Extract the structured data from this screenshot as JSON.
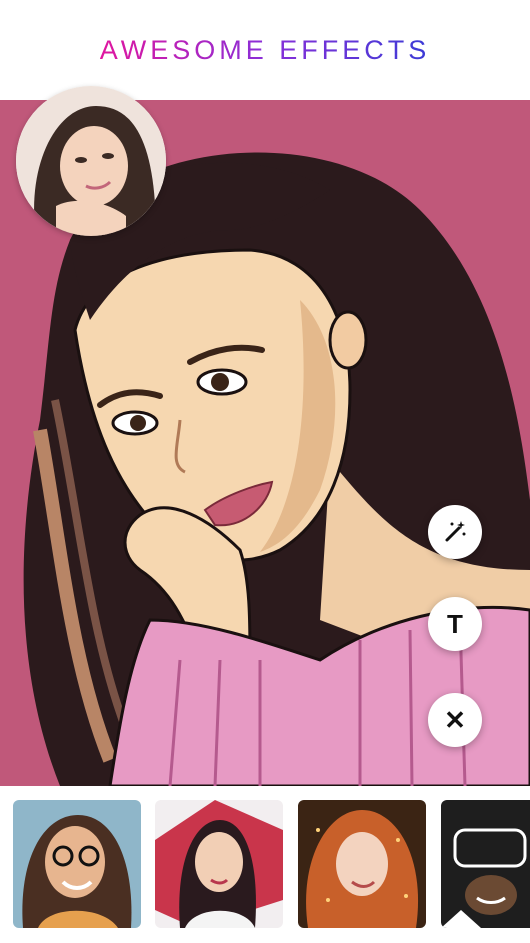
{
  "header": {
    "title": "AWESOME EFFECTS"
  },
  "canvas": {
    "background_color": "#c0587a"
  },
  "avatar": {
    "label": "original-photo-thumbnail"
  },
  "actions": [
    {
      "icon": "magic-wand-icon"
    },
    {
      "icon": "text-icon",
      "glyph": "T"
    },
    {
      "icon": "close-icon",
      "glyph": "✕"
    }
  ],
  "effects": [
    {
      "name": "glasses-girl-cartoon"
    },
    {
      "name": "pop-art-girl"
    },
    {
      "name": "redhead-sparkle"
    },
    {
      "name": "sketch-man"
    }
  ]
}
